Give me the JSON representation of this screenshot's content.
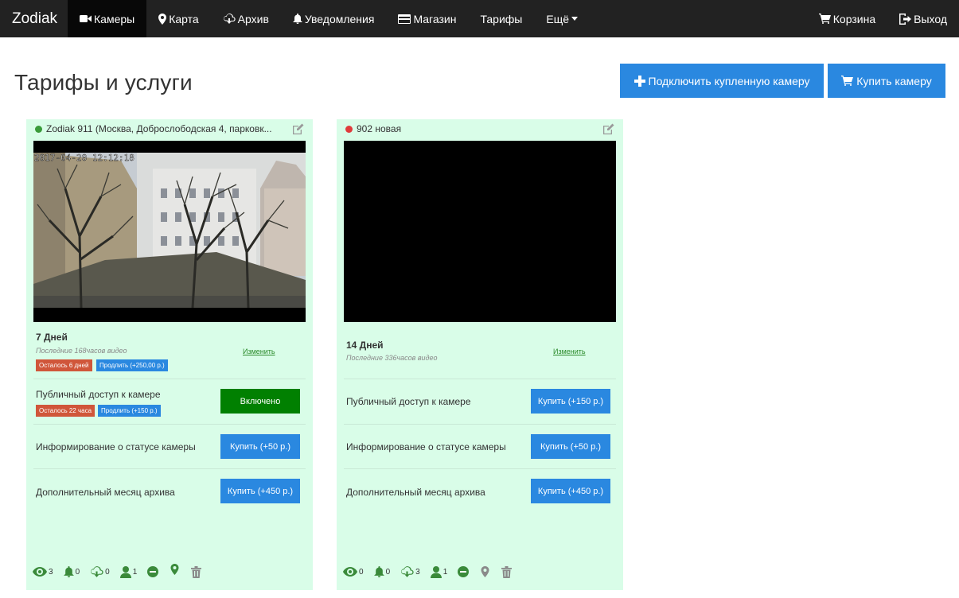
{
  "nav": {
    "brand": "Zodiak",
    "items": [
      {
        "label": "Камеры",
        "icon": "video-camera-icon"
      },
      {
        "label": "Карта",
        "icon": "map-marker-icon"
      },
      {
        "label": "Архив",
        "icon": "cloud-download-icon"
      },
      {
        "label": "Уведомления",
        "icon": "bell-icon"
      },
      {
        "label": "Магазин",
        "icon": "credit-card-icon"
      },
      {
        "label": "Тарифы",
        "icon": ""
      },
      {
        "label": "Ещё",
        "icon": "caret-down-icon"
      }
    ],
    "right": [
      {
        "label": "Корзина",
        "icon": "shopping-cart-icon"
      },
      {
        "label": "Выход",
        "icon": "log-out-icon"
      }
    ]
  },
  "page": {
    "title": "Тарифы и услуги",
    "connect_button": "Подключить купленную камеру",
    "buy_button": "Купить камеру"
  },
  "colors": {
    "accent_blue": "#2a88e0",
    "active_green": "#018001",
    "card_bg": "#d9fde8",
    "badge_red": "#d0563a",
    "navbar": "#222222"
  },
  "cards": [
    {
      "status": "online",
      "title": "Zodiak 911 (Москва, Доброслободская 4, парковк...",
      "video_timestamp": "2017-04-20 12:12:18",
      "tariff": {
        "name": "7 Дней",
        "description": "Последние 168часов видео",
        "change_link": "Изменить",
        "badges": [
          "Осталось 6 дней",
          "Продлить (+250,00 р.)"
        ]
      },
      "services": [
        {
          "label": "Публичный доступ к камере",
          "button": "Включено",
          "active": true,
          "badges": [
            "Осталось 22 часа",
            "Продлить (+150 р.)"
          ]
        },
        {
          "label": "Информирование о статусе камеры",
          "button": "Купить (+50 р.)",
          "active": false
        },
        {
          "label": "Дополнительный месяц архива",
          "button": "Купить (+450 р.)",
          "active": false
        }
      ],
      "footer": {
        "views": "3",
        "notifications": "0",
        "archive": "0",
        "users": "1"
      }
    },
    {
      "status": "offline",
      "title": "902 новая",
      "tariff": {
        "name": "14 Дней",
        "description": "Последние 336часов видео",
        "change_link": "Изменить"
      },
      "services": [
        {
          "label": "Публичный доступ к камере",
          "button": "Купить (+150 р.)",
          "active": false
        },
        {
          "label": "Информирование о статусе камеры",
          "button": "Купить (+50 р.)",
          "active": false
        },
        {
          "label": "Дополнительный месяц архива",
          "button": "Купить (+450 р.)",
          "active": false
        }
      ],
      "footer": {
        "views": "0",
        "notifications": "0",
        "archive": "3",
        "users": "1"
      }
    }
  ]
}
